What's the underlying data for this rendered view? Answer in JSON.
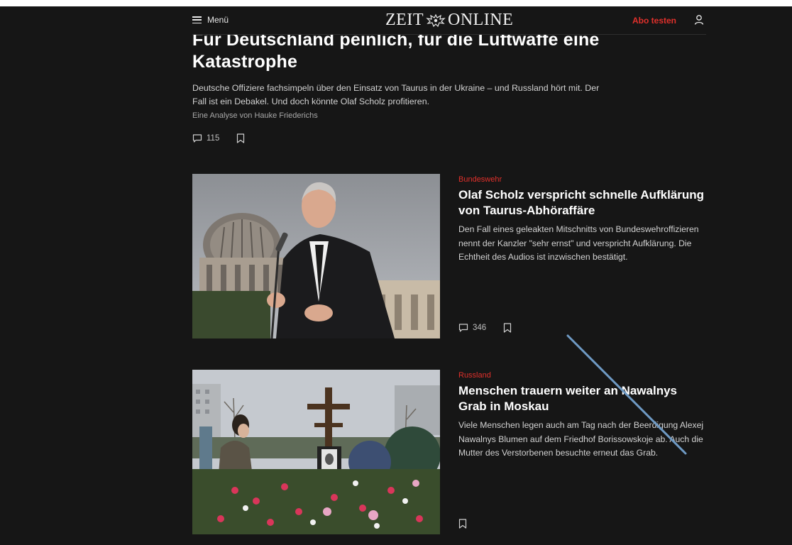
{
  "header": {
    "menu_label": "Menü",
    "logo_left": "ZEIT",
    "logo_right": "ONLINE",
    "abo_label": "Abo testen"
  },
  "lead": {
    "title": "Für Deutschland peinlich, für die Luftwaffe eine Katastrophe",
    "description": "Deutsche Offiziere fachsimpeln über den Einsatz von Taurus in der Ukraine – und Russland hört mit. Der Fall ist ein Debakel. Und doch könnte Olaf Scholz profitieren.",
    "author": "Eine Analyse von Hauke Friederichs",
    "comments": "115"
  },
  "articles": [
    {
      "kicker": "Bundeswehr",
      "title": "Olaf Scholz verspricht schnelle Aufklärung von Taurus-Abhöraffäre",
      "description": "Den Fall eines geleakten Mitschnitts von Bundeswehroffizieren nennt der Kanzler \"sehr ernst\" und verspricht Aufklärung. Die Echtheit des Audios ist inzwischen bestätigt.",
      "comments": "346"
    },
    {
      "kicker": "Russland",
      "title": "Menschen trauern weiter an Nawalnys Grab in Moskau",
      "description": "Viele Menschen legen auch am Tag nach der Beerdigung Alexej Nawalnys Blumen auf dem Friedhof Borissowskoje ab. Auch die Mutter des Verstorbenen besuchte erneut das Grab.",
      "comments": ""
    }
  ],
  "colors": {
    "background": "#161616",
    "accent": "#e0302b",
    "annotation_stroke": "#6f9ac4"
  },
  "icons": [
    "hamburger-icon",
    "eagle-icon",
    "user-icon",
    "comment-icon",
    "bookmark-icon"
  ]
}
